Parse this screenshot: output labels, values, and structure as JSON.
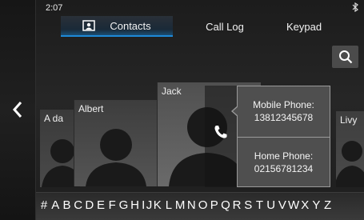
{
  "status": {
    "time": "2:07",
    "bluetooth_icon": "bluetooth-icon"
  },
  "tabs": [
    {
      "label": "Contacts",
      "active": true,
      "icon": "contacts-icon"
    },
    {
      "label": "Call Log",
      "active": false
    },
    {
      "label": "Keypad",
      "active": false
    }
  ],
  "search": {
    "icon": "search-icon"
  },
  "back": {
    "icon": "chevron-left-icon"
  },
  "contacts": [
    {
      "name": "A da"
    },
    {
      "name": "Albert"
    },
    {
      "name": "Jack"
    },
    {
      "name": "Livy"
    }
  ],
  "phone_popup": {
    "mobile": {
      "label": "Mobile Phone:",
      "number": "13812345678"
    },
    "home": {
      "label": "Home  Phone:",
      "number": "02156781234"
    }
  },
  "alphabet": [
    "#",
    "A",
    "B",
    "C",
    "D",
    "E",
    "F",
    "G",
    "H",
    "I",
    "J",
    "K",
    "L",
    "M",
    "N",
    "O",
    "P",
    "Q",
    "R",
    "S",
    "T",
    "U",
    "V",
    "W",
    "X",
    "Y",
    "Z"
  ],
  "colors": {
    "accent": "#1e8ad8",
    "popup_bg": "#4f4f4f",
    "popup_border": "#9a9a9a"
  }
}
